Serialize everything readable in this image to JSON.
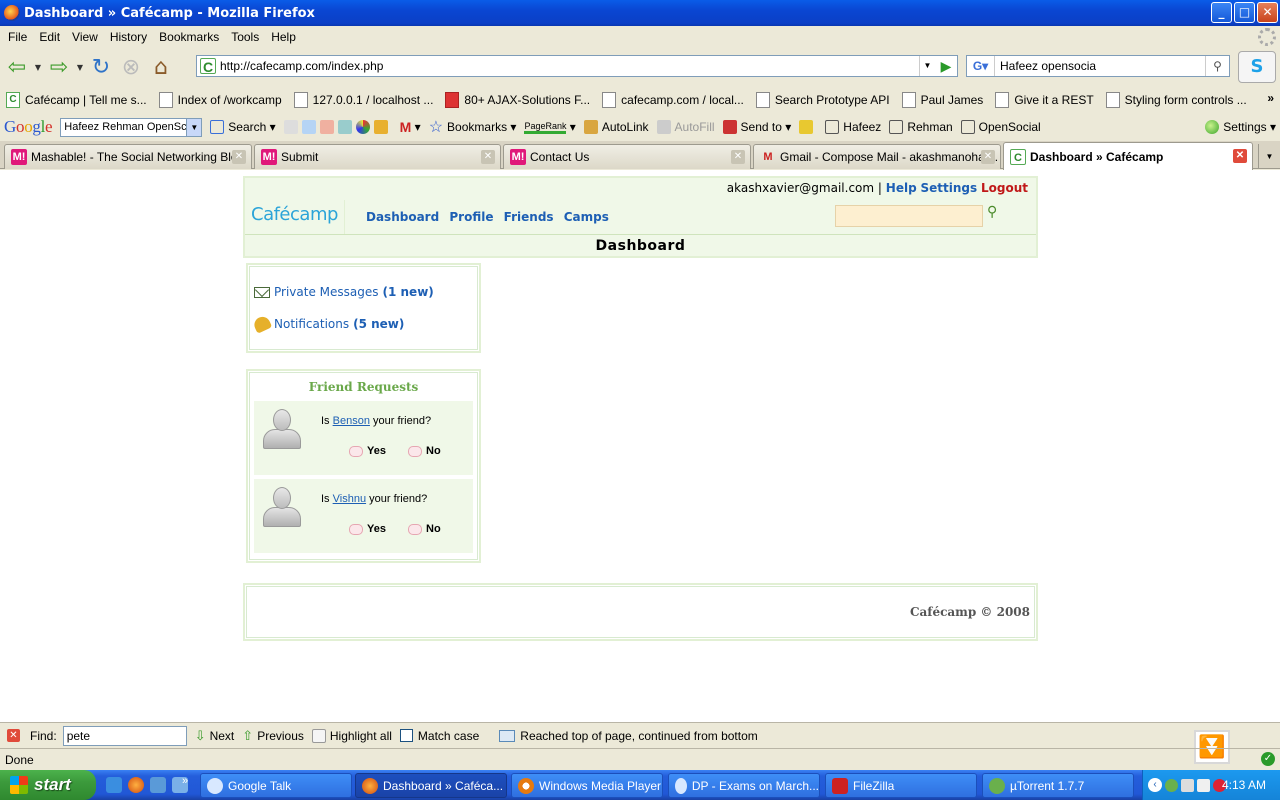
{
  "window": {
    "title": "Dashboard » Cafécamp - Mozilla Firefox",
    "min": "_",
    "max": "□",
    "close": "✕"
  },
  "menu": [
    "File",
    "Edit",
    "View",
    "History",
    "Bookmarks",
    "Tools",
    "Help"
  ],
  "nav": {
    "url": "http://cafecamp.com/index.php",
    "search_value": "Hafeez opensocia"
  },
  "bookmarks": [
    "Cafécamp | Tell me s...",
    "Index of /workcamp",
    "127.0.0.1 / localhost ...",
    "80+ AJAX-Solutions F...",
    "cafecamp.com / local...",
    "Search Prototype API",
    "Paul James",
    "Give it a REST",
    "Styling form controls ..."
  ],
  "google_toolbar": {
    "search_value": "Hafeez Rehman OpenSc",
    "search_label": "Search",
    "bookmarks_label": "Bookmarks",
    "pagerank_label": "PageRank",
    "autolink_label": "AutoLink",
    "autofill_label": "AutoFill",
    "sendto_label": "Send to",
    "hafeez_label": "Hafeez",
    "rehman_label": "Rehman",
    "opensocial_label": "OpenSocial",
    "settings_label": "Settings"
  },
  "tabs": [
    "Mashable! - The Social Networking Blog",
    "Submit",
    "Contact Us",
    "Gmail - Compose Mail - akashmanohar...",
    "Dashboard » Cafécamp"
  ],
  "page": {
    "user_email": "akashxavier@gmail.com",
    "separator": "|",
    "help": "Help",
    "settings": "Settings",
    "logout": "Logout",
    "logo_cafe": "Café",
    "logo_camp": "camp",
    "nav": [
      "Dashboard",
      "Profile",
      "Friends",
      "Camps"
    ],
    "title": "Dashboard",
    "private_messages": "Private Messages",
    "private_messages_count": "(1 new)",
    "notifications": "Notifications",
    "notifications_count": "(5 new)",
    "friend_requests_title": "Friend Requests",
    "requests": [
      {
        "prefix": "Is ",
        "name": "Benson",
        "suffix": " your friend?",
        "yes": "Yes",
        "no": "No"
      },
      {
        "prefix": "Is ",
        "name": "Vishnu",
        "suffix": " your friend?",
        "yes": "Yes",
        "no": "No"
      }
    ],
    "footer": "Cafécamp © 2008"
  },
  "findbar": {
    "label": "Find:",
    "value": "pete",
    "next": "Next",
    "previous": "Previous",
    "highlight_all": "Highlight all",
    "match_case": "Match case",
    "message": "Reached top of page, continued from bottom"
  },
  "status": "Done",
  "taskbar": {
    "start": "start",
    "more": "»",
    "items": [
      "Google Talk",
      "Dashboard » Caféca...",
      "Windows Media Player",
      "DP - Exams on March...",
      "FileZilla",
      "µTorrent 1.7.7"
    ],
    "clock": "4:13 AM"
  }
}
